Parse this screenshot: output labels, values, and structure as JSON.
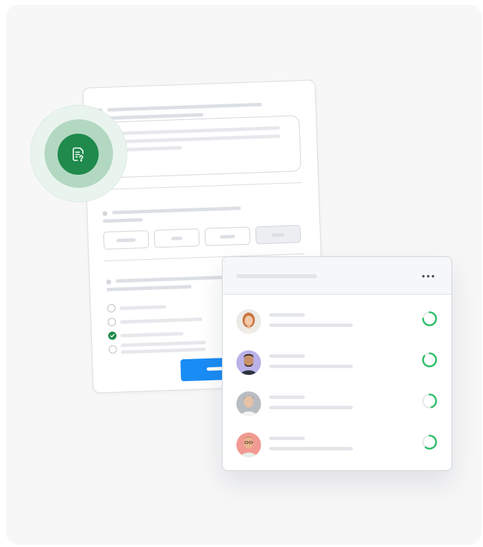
{
  "badge": {
    "icon": "document-question-icon",
    "color": "#1f8a4c"
  },
  "form": {
    "sections": [
      "free-text-question",
      "multiple-choice-buttons",
      "single-choice-radio"
    ],
    "selected_option_index": 3,
    "checked_radio_index": 2,
    "submit_color": "#1a8cf5"
  },
  "panel": {
    "menu_icon": "more-horizontal-icon",
    "respondents": [
      {
        "avatar": "avatar-woman-red-hair",
        "progress": 0.75
      },
      {
        "avatar": "avatar-man-beard",
        "progress": 0.85
      },
      {
        "avatar": "avatar-man-gray",
        "progress": 0.45
      },
      {
        "avatar": "avatar-man-glasses",
        "progress": 0.6
      }
    ],
    "progress_color": "#2fbf6a"
  }
}
